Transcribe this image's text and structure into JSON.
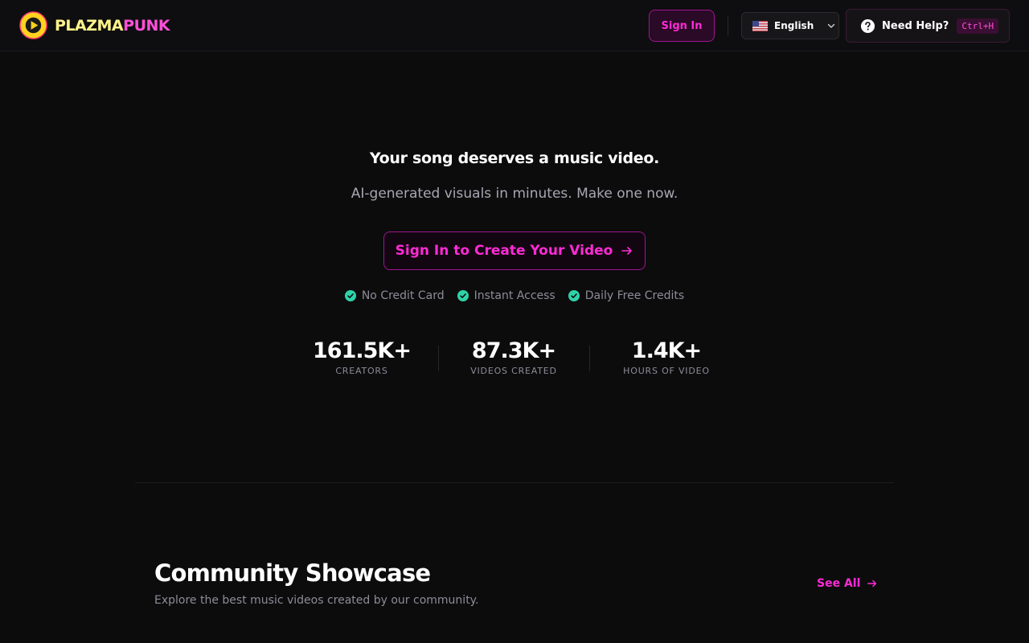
{
  "header": {
    "logo_text_part1": "PLAZMA",
    "logo_text_part2": "PUNK",
    "signin_label": "Sign In",
    "language_label": "English",
    "help_label": "Need Help?",
    "help_shortcut": "Ctrl+H",
    "icons": [
      "play-logo-icon",
      "us-flag-icon",
      "chevron-down-icon",
      "question-circle-icon"
    ]
  },
  "hero": {
    "title": "Your song deserves a music video.",
    "subtitle": "AI-generated visuals in minutes. Make one now.",
    "cta_label": "Sign In to Create Your Video",
    "checks": [
      "No Credit Card",
      "Instant Access",
      "Daily Free Credits"
    ]
  },
  "stats": [
    {
      "value": "161.5K+",
      "label": "CREATORS"
    },
    {
      "value": "87.3K+",
      "label": "VIDEOS CREATED"
    },
    {
      "value": "1.4K+",
      "label": "HOURS OF VIDEO"
    }
  ],
  "showcase": {
    "title": "Community Showcase",
    "subtitle": "Explore the best music videos created by our community.",
    "see_all_label": "See All"
  },
  "colors": {
    "accent": "#ff2bd6",
    "logo_yellow": "#fff48a",
    "check_green": "#2fd3a8",
    "background": "#0c0c0d"
  }
}
